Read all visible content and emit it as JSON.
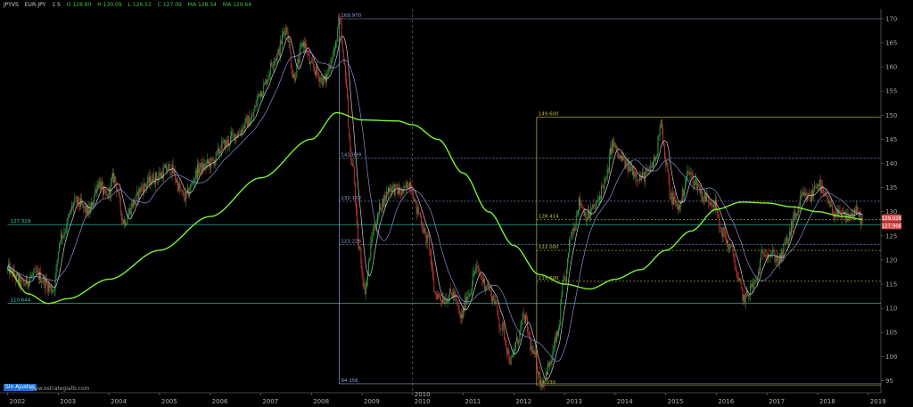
{
  "header": {
    "symbol": "JPYVS",
    "name": "EUR-JPY",
    "timeframe": "1 S",
    "o": "O 128.90",
    "h": "H 130.09",
    "l": "L 126.53",
    "c": "C 127.09",
    "ma1": "MA 128.54",
    "ma2": "MA 129.64"
  },
  "badge": "Sin Ajustes",
  "watermark": "www.estrategiatb.com",
  "chart_data": {
    "type": "candlestick",
    "x_axis_labels": [
      "2002",
      "2003",
      "2004",
      "2005",
      "2006",
      "2007",
      "2008",
      "2009",
      "2010",
      "2011",
      "2012",
      "2013",
      "2014",
      "2015",
      "2016",
      "2017",
      "2018",
      "2019"
    ],
    "x_marker_label": "2010",
    "y_tick_labels": [
      95,
      100,
      105,
      110,
      115,
      120,
      125,
      130,
      135,
      140,
      145,
      150,
      155,
      160,
      165,
      170
    ],
    "ylim": [
      92.5,
      172
    ],
    "anchor_points": [
      {
        "t": 2002.0,
        "v": 118
      },
      {
        "t": 2002.3,
        "v": 115
      },
      {
        "t": 2002.55,
        "v": 117
      },
      {
        "t": 2002.9,
        "v": 114
      },
      {
        "t": 2003.05,
        "v": 125
      },
      {
        "t": 2003.35,
        "v": 132
      },
      {
        "t": 2003.6,
        "v": 130
      },
      {
        "t": 2003.8,
        "v": 136
      },
      {
        "t": 2003.95,
        "v": 133
      },
      {
        "t": 2004.1,
        "v": 137
      },
      {
        "t": 2004.3,
        "v": 128
      },
      {
        "t": 2004.5,
        "v": 132
      },
      {
        "t": 2004.65,
        "v": 135
      },
      {
        "t": 2004.9,
        "v": 137
      },
      {
        "t": 2005.2,
        "v": 139
      },
      {
        "t": 2005.5,
        "v": 133
      },
      {
        "t": 2005.8,
        "v": 139
      },
      {
        "t": 2006.0,
        "v": 140
      },
      {
        "t": 2006.3,
        "v": 144
      },
      {
        "t": 2006.5,
        "v": 146
      },
      {
        "t": 2006.8,
        "v": 149
      },
      {
        "t": 2007.0,
        "v": 155
      },
      {
        "t": 2007.3,
        "v": 162
      },
      {
        "t": 2007.5,
        "v": 168
      },
      {
        "t": 2007.65,
        "v": 158
      },
      {
        "t": 2007.85,
        "v": 165
      },
      {
        "t": 2008.0,
        "v": 160
      },
      {
        "t": 2008.25,
        "v": 157
      },
      {
        "t": 2008.45,
        "v": 163
      },
      {
        "t": 2008.55,
        "v": 169.5
      },
      {
        "t": 2008.65,
        "v": 160
      },
      {
        "t": 2008.8,
        "v": 140
      },
      {
        "t": 2008.95,
        "v": 122
      },
      {
        "t": 2009.05,
        "v": 114
      },
      {
        "t": 2009.25,
        "v": 127
      },
      {
        "t": 2009.4,
        "v": 132
      },
      {
        "t": 2009.55,
        "v": 135
      },
      {
        "t": 2009.8,
        "v": 134
      },
      {
        "t": 2009.95,
        "v": 136
      },
      {
        "t": 2010.1,
        "v": 130
      },
      {
        "t": 2010.3,
        "v": 124
      },
      {
        "t": 2010.45,
        "v": 113
      },
      {
        "t": 2010.6,
        "v": 112
      },
      {
        "t": 2010.8,
        "v": 113
      },
      {
        "t": 2010.95,
        "v": 108
      },
      {
        "t": 2011.1,
        "v": 113
      },
      {
        "t": 2011.25,
        "v": 118
      },
      {
        "t": 2011.45,
        "v": 115
      },
      {
        "t": 2011.6,
        "v": 112
      },
      {
        "t": 2011.75,
        "v": 106
      },
      {
        "t": 2011.95,
        "v": 99
      },
      {
        "t": 2012.05,
        "v": 103
      },
      {
        "t": 2012.2,
        "v": 108
      },
      {
        "t": 2012.4,
        "v": 100
      },
      {
        "t": 2012.55,
        "v": 94.5
      },
      {
        "t": 2012.7,
        "v": 98
      },
      {
        "t": 2012.85,
        "v": 104
      },
      {
        "t": 2013.0,
        "v": 116
      },
      {
        "t": 2013.15,
        "v": 126
      },
      {
        "t": 2013.3,
        "v": 132
      },
      {
        "t": 2013.45,
        "v": 129
      },
      {
        "t": 2013.6,
        "v": 131
      },
      {
        "t": 2013.8,
        "v": 136
      },
      {
        "t": 2013.95,
        "v": 144
      },
      {
        "t": 2014.1,
        "v": 141
      },
      {
        "t": 2014.3,
        "v": 139
      },
      {
        "t": 2014.5,
        "v": 137
      },
      {
        "t": 2014.65,
        "v": 138
      },
      {
        "t": 2014.8,
        "v": 141
      },
      {
        "t": 2014.9,
        "v": 149
      },
      {
        "t": 2015.0,
        "v": 140
      },
      {
        "t": 2015.1,
        "v": 133
      },
      {
        "t": 2015.25,
        "v": 131
      },
      {
        "t": 2015.45,
        "v": 138
      },
      {
        "t": 2015.6,
        "v": 136
      },
      {
        "t": 2015.75,
        "v": 133
      },
      {
        "t": 2015.95,
        "v": 132
      },
      {
        "t": 2016.1,
        "v": 126
      },
      {
        "t": 2016.3,
        "v": 122
      },
      {
        "t": 2016.45,
        "v": 115
      },
      {
        "t": 2016.55,
        "v": 112
      },
      {
        "t": 2016.75,
        "v": 115
      },
      {
        "t": 2016.95,
        "v": 122
      },
      {
        "t": 2017.1,
        "v": 121
      },
      {
        "t": 2017.25,
        "v": 120
      },
      {
        "t": 2017.4,
        "v": 124
      },
      {
        "t": 2017.55,
        "v": 129
      },
      {
        "t": 2017.7,
        "v": 133
      },
      {
        "t": 2017.85,
        "v": 133
      },
      {
        "t": 2018.0,
        "v": 136
      },
      {
        "t": 2018.15,
        "v": 133
      },
      {
        "t": 2018.3,
        "v": 130
      },
      {
        "t": 2018.45,
        "v": 129
      },
      {
        "t": 2018.6,
        "v": 129
      },
      {
        "t": 2018.75,
        "v": 130
      },
      {
        "t": 2018.9,
        "v": 128
      }
    ],
    "ma_long_anchors": [
      {
        "t": 2002.0,
        "v": 118
      },
      {
        "t": 2002.4,
        "v": 113
      },
      {
        "t": 2002.8,
        "v": 111
      },
      {
        "t": 2003.2,
        "v": 112
      },
      {
        "t": 2004.0,
        "v": 116
      },
      {
        "t": 2005.0,
        "v": 122
      },
      {
        "t": 2006.0,
        "v": 129
      },
      {
        "t": 2007.0,
        "v": 137
      },
      {
        "t": 2008.0,
        "v": 145
      },
      {
        "t": 2008.5,
        "v": 150.5
      },
      {
        "t": 2009.0,
        "v": 149
      },
      {
        "t": 2009.7,
        "v": 148.8
      },
      {
        "t": 2010.0,
        "v": 148
      },
      {
        "t": 2010.5,
        "v": 145
      },
      {
        "t": 2011.0,
        "v": 138
      },
      {
        "t": 2011.5,
        "v": 130
      },
      {
        "t": 2012.0,
        "v": 123
      },
      {
        "t": 2012.5,
        "v": 117
      },
      {
        "t": 2013.0,
        "v": 115
      },
      {
        "t": 2013.5,
        "v": 114
      },
      {
        "t": 2014.0,
        "v": 116
      },
      {
        "t": 2014.5,
        "v": 118
      },
      {
        "t": 2015.0,
        "v": 122
      },
      {
        "t": 2015.5,
        "v": 126
      },
      {
        "t": 2016.0,
        "v": 130.5
      },
      {
        "t": 2016.5,
        "v": 132
      },
      {
        "t": 2017.0,
        "v": 131.8
      },
      {
        "t": 2017.5,
        "v": 131
      },
      {
        "t": 2018.0,
        "v": 130
      },
      {
        "t": 2018.5,
        "v": 129
      },
      {
        "t": 2018.9,
        "v": 128.4
      }
    ],
    "horizontal_levels": [
      {
        "value": 127.329,
        "label": "127.329",
        "color": "#3ccfb6",
        "style": "solid",
        "from": 2002.0,
        "to": 2019.2
      },
      {
        "value": 111.0,
        "label": "110.644",
        "color": "#3ccfb6",
        "style": "solid",
        "from": 2002.0,
        "to": 2019.2
      }
    ],
    "fib_left": {
      "color": "#8f9fd8",
      "from_t": 2008.55,
      "high": 169.97,
      "low": 94.356,
      "levels": [
        {
          "value": 169.97,
          "label": "169.970",
          "style": "solid"
        },
        {
          "value": 141.099,
          "label": "141.099",
          "style": "dotted"
        },
        {
          "value": 132.162,
          "label": "132.162",
          "style": "dotted"
        },
        {
          "value": 123.226,
          "label": "123.226",
          "style": "dotted"
        },
        {
          "value": 94.356,
          "label": "94.356",
          "style": "solid"
        }
      ]
    },
    "fib_right": {
      "color": "#c4c42a",
      "from_t": 2012.45,
      "high": 149.6,
      "low": 94.0,
      "levels": [
        {
          "value": 149.6,
          "label": "149.600",
          "style": "solid"
        },
        {
          "value": 128.414,
          "label": "128.414",
          "style": "dotted"
        },
        {
          "value": 122.0,
          "label": "122.000",
          "style": "dotted"
        },
        {
          "value": 115.6,
          "label": "115.600",
          "style": "dotted"
        },
        {
          "value": 94.0,
          "label": "94.030",
          "style": "solid"
        }
      ]
    },
    "price_labels": [
      {
        "value": 128.7,
        "label": "129.026",
        "color": "#e05050"
      },
      {
        "value": 127.1,
        "label": "127.906",
        "color": "#e05050"
      }
    ],
    "colors": {
      "up": "#2fa84a",
      "down": "#d03838",
      "ma_long": "#7cf034",
      "ma_fast": "#c8ccd8",
      "ma_mid": "#8a8fd0",
      "vertical_marker": "#6a6a6a",
      "grid": "#2a2a2a"
    }
  }
}
